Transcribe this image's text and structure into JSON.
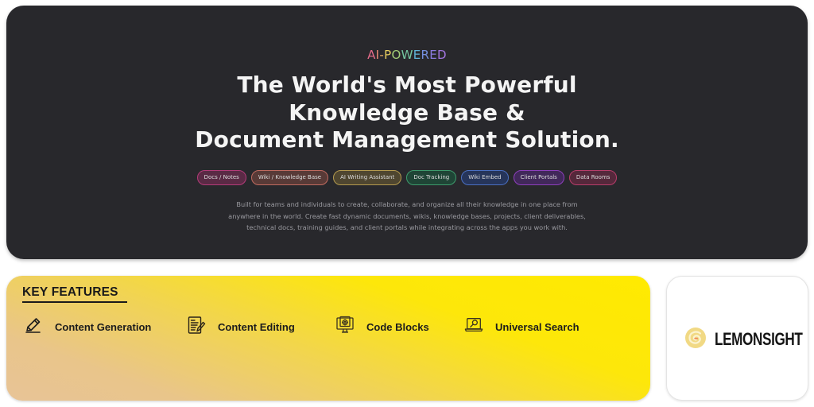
{
  "hero": {
    "eyebrow": "AI-POWERED",
    "eyebrow_gradient": [
      "#e56b8a",
      "#f09a68",
      "#e9cf5f",
      "#7fce83",
      "#5fb4d9",
      "#7f7de0",
      "#a276e0"
    ],
    "headline_lines": [
      "The World's Most Powerful",
      "Knowledge Base &",
      "Document Management Solution."
    ],
    "tags": [
      {
        "label": "Docs / Notes",
        "border": "#b43b79",
        "bg": "#5a2a45"
      },
      {
        "label": "Wiki / Knowledge Base",
        "border": "#c06a5f",
        "bg": "#583a37"
      },
      {
        "label": "AI Writing Assistant",
        "border": "#b49a4e",
        "bg": "#4f4630"
      },
      {
        "label": "Doc Tracking",
        "border": "#3d9b6c",
        "bg": "#1f4536"
      },
      {
        "label": "Wiki Embed",
        "border": "#4a6fc2",
        "bg": "#26355a"
      },
      {
        "label": "Client Portals",
        "border": "#8d3fbd",
        "bg": "#41285a"
      },
      {
        "label": "Data Rooms",
        "border": "#b83d6a",
        "bg": "#55283b"
      }
    ],
    "description_lines": [
      "Built for teams and individuals to create, collaborate, and organize all their knowledge in one place from",
      "anywhere in the world. Create fast dynamic documents, wikis, knowledge bases, projects, client deliverables,",
      "technical docs, training guides, and client portals while integrating across the apps you work with."
    ]
  },
  "features": {
    "title": "KEY FEATURES",
    "items": [
      {
        "label": "Content Generation",
        "icon": "pencil-icon"
      },
      {
        "label": "Content Editing",
        "icon": "document-edit-icon"
      },
      {
        "label": "Code Blocks",
        "icon": "monitor-gear-icon"
      },
      {
        "label": "Universal Search",
        "icon": "laptop-search-icon"
      }
    ]
  },
  "brand": {
    "name": "LEMONSIGHT",
    "logo_icon": "lemon-swirl-icon"
  }
}
